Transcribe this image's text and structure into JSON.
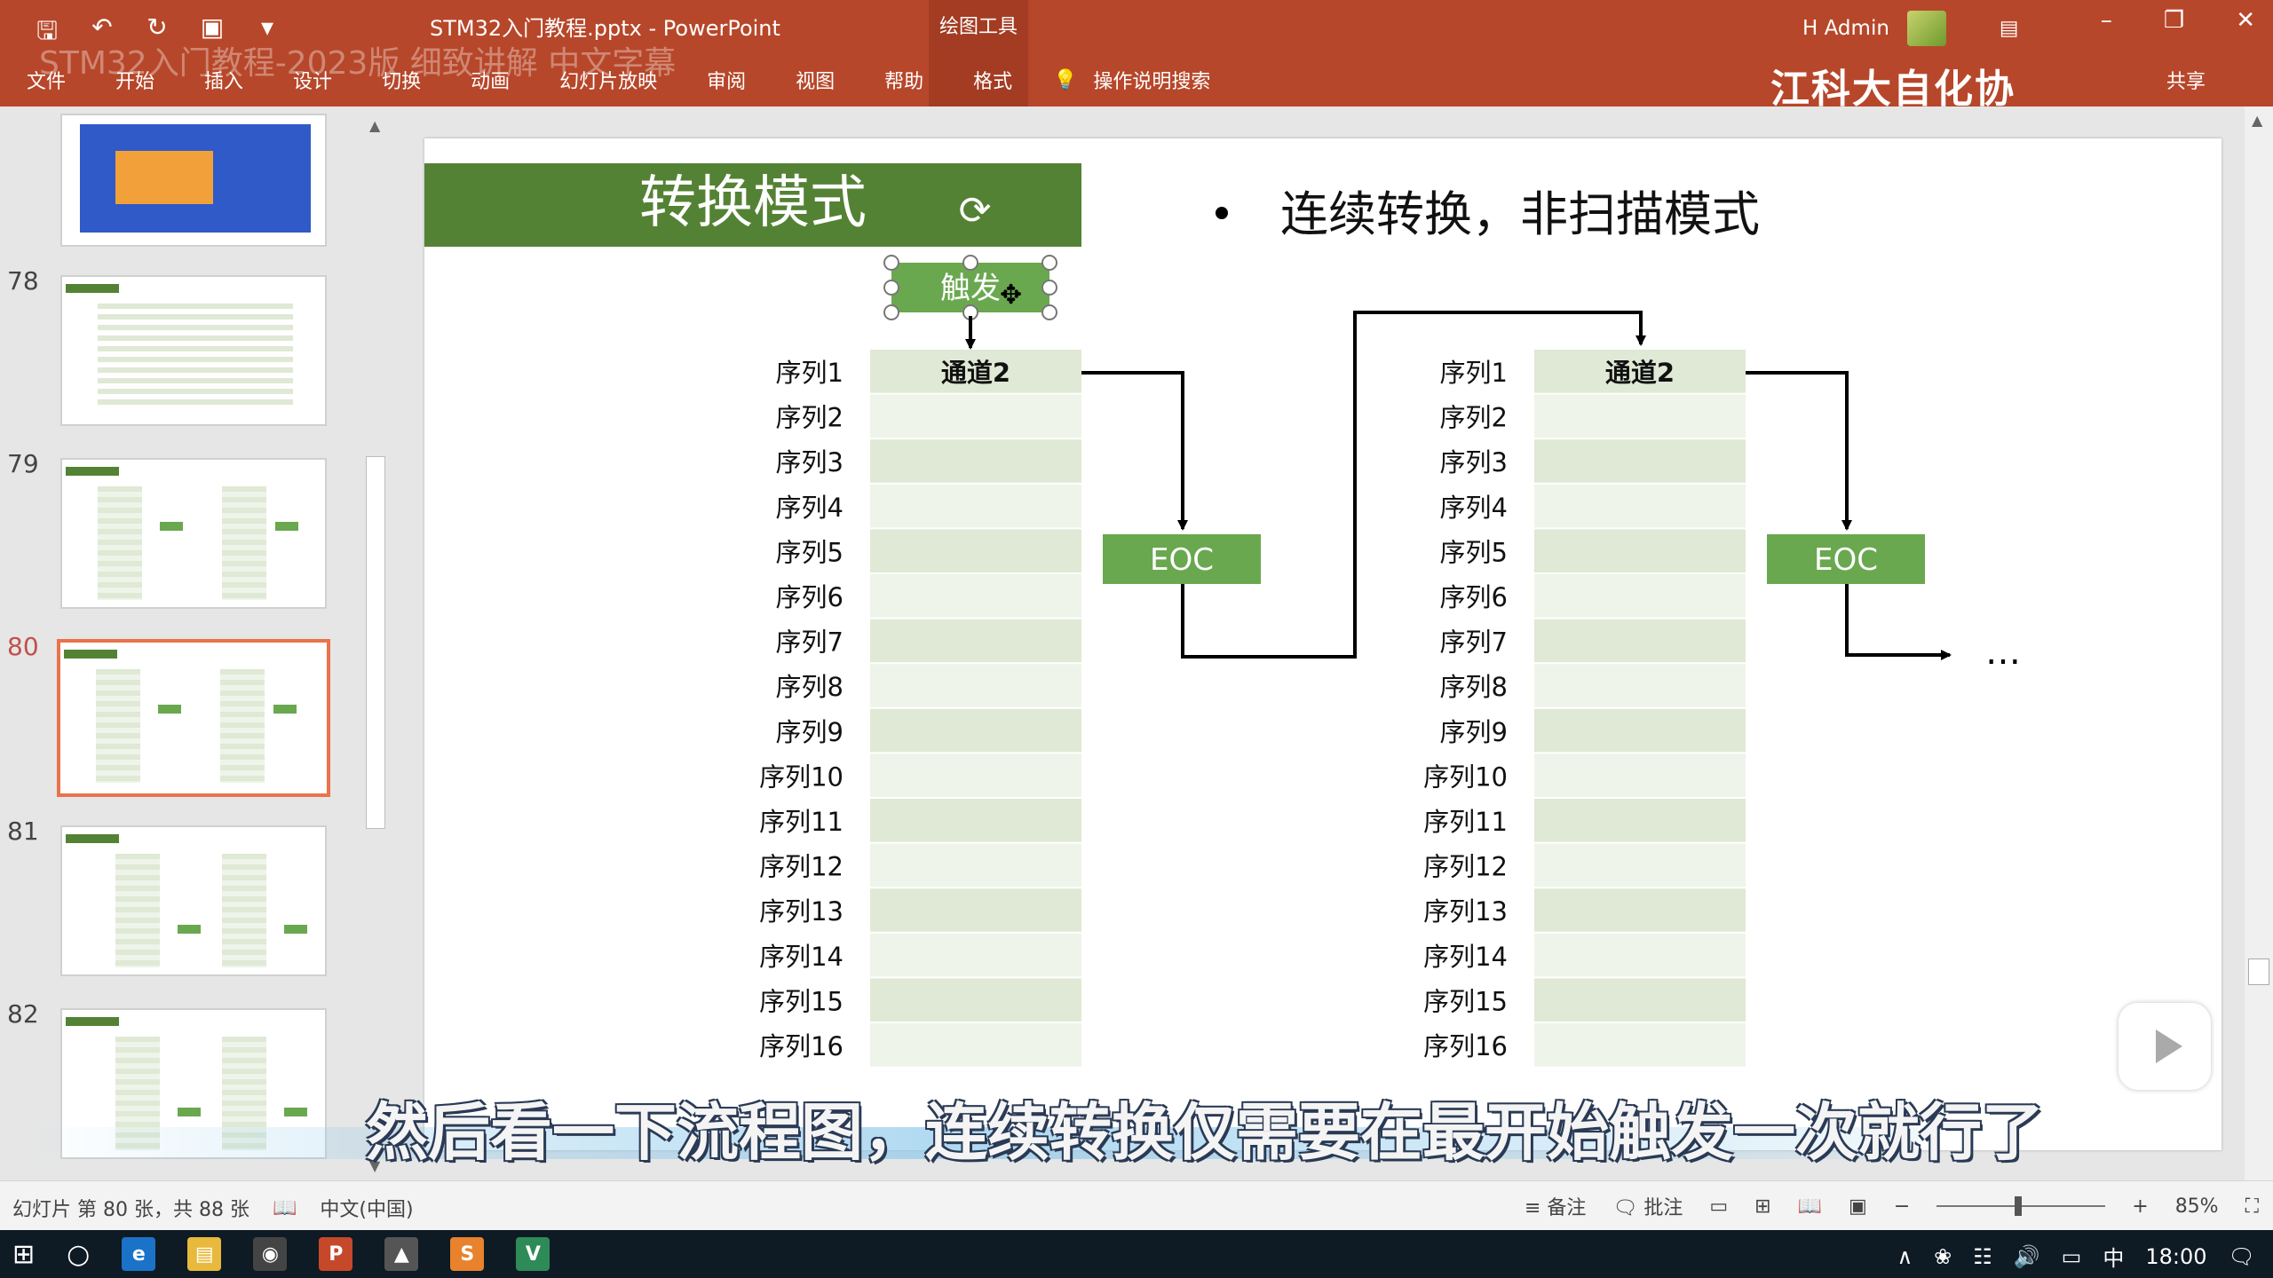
{
  "titlebar": {
    "doc_title": "STM32入门教程.pptx - PowerPoint",
    "context_tab_group": "绘图工具",
    "user_name": "H Admin",
    "watermark": "STM32入门教程-2023版 细致讲解 中文字幕",
    "brand": "江科大自化协",
    "brand_logo": "bilibili",
    "ribbon_search": "共享"
  },
  "ribbon": {
    "tabs": [
      "文件",
      "开始",
      "插入",
      "设计",
      "切换",
      "动画",
      "幻灯片放映",
      "审阅",
      "视图",
      "帮助",
      "格式"
    ],
    "tell_me": "操作说明搜索"
  },
  "thumbnails": {
    "numbers": [
      "78",
      "79",
      "80",
      "81",
      "82"
    ],
    "selected": "80"
  },
  "slide": {
    "title": "转换模式",
    "bullet": "连续转换，非扫描模式",
    "trigger": "触发",
    "channel_header": "通道2",
    "eoc": "EOC",
    "ellipsis": "…",
    "sequences": [
      "序列1",
      "序列2",
      "序列3",
      "序列4",
      "序列5",
      "序列6",
      "序列7",
      "序列8",
      "序列9",
      "序列10",
      "序列11",
      "序列12",
      "序列13",
      "序列14",
      "序列15",
      "序列16"
    ]
  },
  "subtitle": "然后看一下流程图，连续转换仅需要在最开始触发一次就行了",
  "statusbar": {
    "slide_info": "幻灯片 第 80 张，共 88 张",
    "language": "中文(中国)",
    "notes": "备注",
    "comments": "批注",
    "zoom": "85%",
    "zoom_minus": "−",
    "zoom_plus": "+"
  },
  "taskbar": {
    "ime": "中",
    "time": "18:00"
  },
  "colors": {
    "accent": "#b7472a",
    "slide_green": "#548235",
    "eoc_green": "#6aa84f"
  }
}
